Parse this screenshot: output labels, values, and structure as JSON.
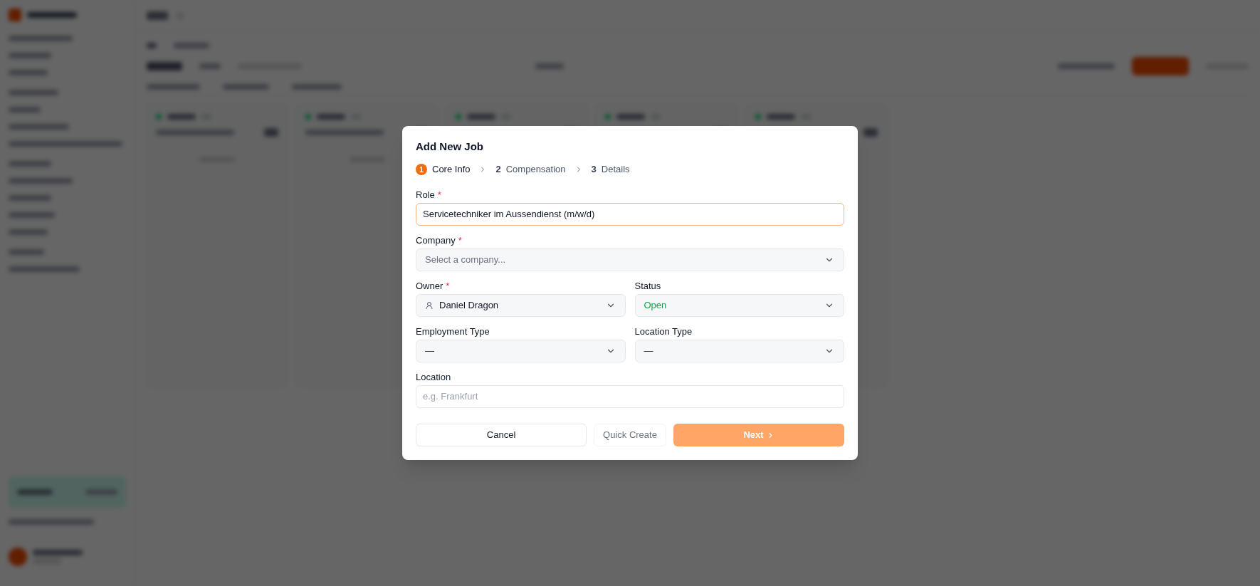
{
  "dialog": {
    "title": "Add New Job",
    "steps": [
      {
        "number": "1",
        "label": "Core Info",
        "selected": true
      },
      {
        "number": "2",
        "label": "Compensation",
        "selected": false
      },
      {
        "number": "3",
        "label": "Details",
        "selected": false
      }
    ],
    "rows": [
      {
        "fields": [
          {
            "kind": "text",
            "label": "Role",
            "required_mark": "*",
            "value": "Servicetechniker im Aussendienst (m/w/d)",
            "focused": true
          }
        ]
      },
      {
        "fields": [
          {
            "kind": "select",
            "label": "Company",
            "required_mark": "*",
            "placeholder": "Select a company..."
          }
        ]
      },
      {
        "fields": [
          {
            "kind": "user-select",
            "label": "Owner",
            "required_mark": "*",
            "value": "Daniel Dragon"
          },
          {
            "kind": "select",
            "label": "Status",
            "value": "Open",
            "color": "#16a34a"
          }
        ]
      },
      {
        "fields": [
          {
            "kind": "select",
            "label": "Employment Type",
            "value": "—"
          },
          {
            "kind": "select",
            "label": "Location Type",
            "value": "—"
          }
        ]
      },
      {
        "fields": [
          {
            "kind": "text",
            "label": "Location",
            "placeholder": "e.g. Frankfurt",
            "focused": false
          }
        ]
      }
    ],
    "buttons": [
      {
        "kind": "secondary",
        "label": "Cancel",
        "disabled": false
      },
      {
        "kind": "ghost",
        "label": "Quick Create",
        "disabled": true
      },
      {
        "kind": "primary",
        "label": "Next",
        "disabled": true
      }
    ]
  }
}
